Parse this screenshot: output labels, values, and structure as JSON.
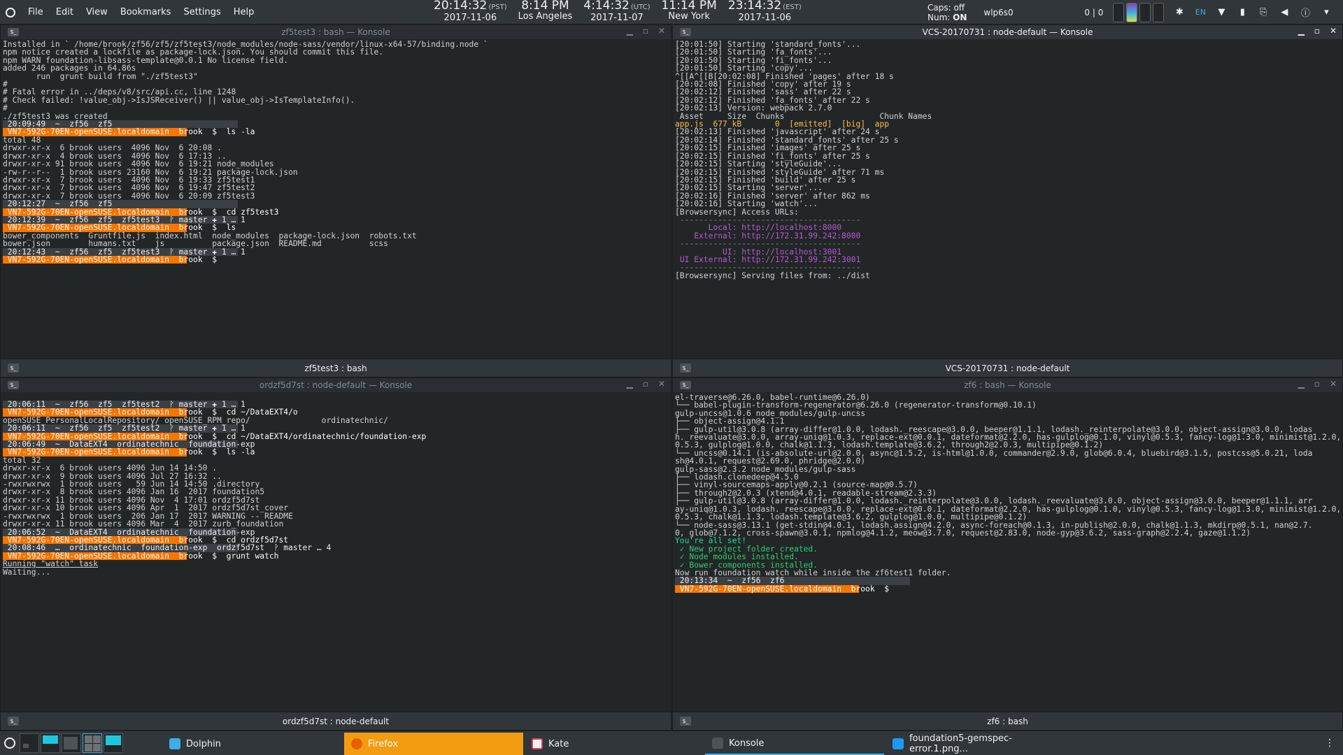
{
  "menubar": {
    "items": [
      "File",
      "Edit",
      "View",
      "Bookmarks",
      "Settings",
      "Help"
    ]
  },
  "clocks": [
    {
      "time": "20:14:32",
      "zone": "(PST)",
      "date": "2017-11-06",
      "city": ""
    },
    {
      "time": "8:14 PM",
      "zone": "",
      "date": "",
      "city": "Los Angeles"
    },
    {
      "time": "4:14:32",
      "zone": "(UTC)",
      "date": "2017-11-07",
      "city": ""
    },
    {
      "time": "11:14 PM",
      "zone": "",
      "date": "",
      "city": "New York"
    },
    {
      "time": "23:14:32",
      "zone": "(EST)",
      "date": "2017-11-06",
      "city": ""
    }
  ],
  "tray": {
    "caps": "Caps: off",
    "num_label": "Num:",
    "num_value": "ON",
    "network": "wlp6s0",
    "pager_text": "0 | 0",
    "lang": "EN"
  },
  "windows": {
    "tl": {
      "title": "zf5test3 : bash — Konsole",
      "tab": "zf5test3 : bash"
    },
    "tr": {
      "title": "VCS-20170731 : node-default — Konsole",
      "tab": "VCS-20170731 : node-default"
    },
    "bl": {
      "title": "ordzf5d7st : node-default — Konsole",
      "tab": "ordzf5d7st : node-default"
    },
    "br": {
      "title": "zf6 : bash — Konsole",
      "tab": "zf6 : bash"
    }
  },
  "term_tl": [
    "Installed in ` /home/brook/zf56/zf5/zf5test3/node_modules/node-sass/vendor/linux-x64-57/binding.node `",
    "npm notice created a lockfile as package-lock.json. You should commit this file.",
    "npm WARN foundation-libsass-template@0.0.1 No license field.",
    "",
    "added 246 packages in 64.86s",
    "       run  grunt build from \"./zf5test3\"",
    "",
    "",
    "#",
    "# Fatal error in ../deps/v8/src/api.cc, line 1248",
    "# Check failed: !value_obj->IsJSReceiver() || value_obj->IsTemplateInfo().",
    "#",
    "./zf5test3 was created",
    " 20:09:49  ~  zf56  zf5",
    " VN7-592G-70EN-openSUSE.localdomain  brook  $  ls -la",
    "total 48",
    "drwxr-xr-x  6 brook users  4096 Nov  6 20:08 .",
    "drwxr-xr-x  4 brook users  4096 Nov  6 17:13 ..",
    "drwxr-xr-x 91 brook users  4096 Nov  6 19:21 node_modules",
    "-rw-r--r--  1 brook users 23160 Nov  6 19:21 package-lock.json",
    "drwxr-xr-x  7 brook users  4096 Nov  6 19:33 zf5test1",
    "drwxr-xr-x  7 brook users  4096 Nov  6 19:47 zf5test2",
    "drwxr-xr-x  7 brook users  4096 Nov  6 20:09 zf5test3",
    " 20:12:27  ~  zf56  zf5",
    " VN7-592G-70EN-openSUSE.localdomain  brook  $  cd zf5test3",
    " 20:12:39  ~  zf56  zf5  zf5test3  ᚹ master ✚ 1 … 1",
    " VN7-592G-70EN-openSUSE.localdomain  brook  $  ls",
    "bower_components  Gruntfile.js  index.html  node_modules  package-lock.json  robots.txt",
    "bower.json        humans.txt    js          package.json  README.md          scss",
    " 20:12:43  ~  zf56  zf5  zf5test3  ᚹ master ✚ 1 … 1",
    " VN7-592G-70EN-openSUSE.localdomain  brook  $  "
  ],
  "term_tr": [
    "[20:01:50] Starting 'standard_fonts'...",
    "[20:01:50] Starting 'fa_fonts'...",
    "[20:01:50] Starting 'fi_fonts'...",
    "[20:01:50] Starting 'copy'...",
    "^[[A^[[B[20:02:08] Finished 'pages' after 18 s",
    "[20:02:08] Finished 'copy' after 19 s",
    "[20:02:12] Finished 'sass' after 22 s",
    "[20:02:12] Finished 'fa_fonts' after 22 s",
    "[20:02:13] Version: webpack 2.7.0",
    " Asset     Size  Chunks                    Chunk Names",
    "app.js  677 kB       0  [emitted]  [big]  app",
    "[20:02:13] Finished 'javascript' after 24 s",
    "[20:02:14] Finished 'standard_fonts' after 25 s",
    "[20:02:15] Finished 'images' after 25 s",
    "[20:02:15] Finished 'fi_fonts' after 25 s",
    "[20:02:15] Starting 'styleGuide'...",
    "[20:02:15] Finished 'styleGuide' after 71 ms",
    "[20:02:15] Finished 'build' after 25 s",
    "[20:02:15] Starting 'server'...",
    "[20:02:16] Finished 'server' after 862 ms",
    "[20:02:16] Starting 'watch'...",
    "[Browsersync] Access URLs:",
    " --------------------------------------",
    "       Local: http://localhost:8000",
    "    External: http://172.31.99.242:8000",
    " --------------------------------------",
    "          UI: http://localhost:3001",
    " UI External: http://172.31.99.242:3001",
    " --------------------------------------",
    "[Browsersync] Serving files from: ../dist",
    ""
  ],
  "term_bl": [
    " 20:06:11  ~  zf56  zf5  zf5test2  ᚹ master ✚ 1 … 1",
    " VN7-592G-70EN-openSUSE.localdomain  brook  $  cd ~/DataEXT4/o",
    "openSUSE_PersonalLocalRepository/ openSUSE_RPM_repo/               ordinatechnic/",
    " 20:06:11  ~  zf56  zf5  zf5test2  ᚹ master ✚ 1 … 1",
    " VN7-592G-70EN-openSUSE.localdomain  brook  $  cd ~/DataEXT4/ordinatechnic/foundation-exp",
    " 20:06:49  ~  DataEXT4  ordinatechnic  foundation-exp",
    " VN7-592G-70EN-openSUSE.localdomain  brook  $  ls -la",
    "total 32",
    "drwxr-xr-x  6 brook users 4096 Jun 14 14:50 .",
    "drwxr-xr-x  9 brook users 4096 Jul 27 16:32 ..",
    "-rwxrwxrwx  1 brook users   59 Jun 14 14:50 .directory",
    "drwxr-xr-x  8 brook users 4096 Jan 16  2017 foundation5",
    "drwxr-xr-x 11 brook users 4096 Nov  4 17:01 ordzf5d7st",
    "drwxr-xr-x 10 brook users 4096 Apr  1  2017 ordzf5d7st_cover",
    "-rwxrwxrwx  1 brook users  206 Jan 17  2017 WARNING -- README",
    "drwxr-xr-x 11 brook users 4096 Mar  4  2017 zurb_foundation",
    " 20:06:52  ~  DataEXT4  ordinatechnic  foundation-exp",
    " VN7-592G-70EN-openSUSE.localdomain  brook  $  cd ordzf5d7st",
    " 20:08:46  …  ordinatechnic  foundation-exp  ordzf5d7st  ᚹ master … 4",
    " VN7-592G-70EN-openSUSE.localdomain  brook  $  grunt watch",
    "Running \"watch\" task",
    "Waiting...",
    ""
  ],
  "term_br": [
    "el-traverse@6.26.0, babel-runtime@6.26.0)",
    "└── babel-plugin-transform-regenerator@6.26.0 (regenerator-transform@0.10.1)",
    "",
    "gulp-uncss@1.0.6 node_modules/gulp-uncss",
    "├── object-assign@4.1.1",
    "├── gulp-util@3.0.8 (array-differ@1.0.0, lodash._reescape@3.0.0, beeper@1.1.1, lodash._reinterpolate@3.0.0, object-assign@3.0.0, lodas",
    "h._reevaluate@3.0.0, array-uniq@1.0.3, replace-ext@0.0.1, dateformat@2.2.0, has-gulplog@0.1.0, vinyl@0.5.3, fancy-log@1.3.0, minimist@1.2.0, vinyl@",
    "0.5.3, gulplog@1.0.0, chalk@1.1.3, lodash.template@3.6.2, through2@2.0.3, multipipe@0.1.2)",
    "└── uncss@0.14.1 (is-absolute-url@2.0.0, async@1.5.2, is-html@1.0.0, commander@2.9.0, glob@6.0.4, bluebird@3.1.5, postcss@5.0.21, loda",
    "sh@4.0.1, request@2.69.0, phridge@2.0.0)",
    "",
    "gulp-sass@2.3.2 node_modules/gulp-sass",
    "├── lodash.clonedeep@4.5.0",
    "├── vinyl-sourcemaps-apply@0.2.1 (source-map@0.5.7)",
    "├── through2@2.0.3 (xtend@4.0.1, readable-stream@2.3.3)",
    "├── gulp-util@3.0.8 (array-differ@1.0.0, lodash._reinterpolate@3.0.0, lodash._reevaluate@3.0.0, object-assign@3.0.0, beeper@1.1.1, arr",
    "ay-uniq@1.0.3, lodash._reescape@3.0.0, replace-ext@0.0.1, dateformat@2.2.0, has-gulplog@0.1.0, vinyl@0.5.3, fancy-log@1.3.0, minimist@1.2.0, vinyl@",
    "0.5.3, chalk@1.1.3, lodash.template@3.6.2, gulplog@1.0.0, multipipe@0.1.2)",
    "└── node-sass@3.13.1 (get-stdin@4.0.1, lodash.assign@4.2.0, async-foreach@0.1.3, in-publish@2.0.0, chalk@1.1.3, mkdirp@0.5.1, nan@2.7.",
    "0, glob@7.1.2, cross-spawn@3.0.1, npmlog@4.1.2, meow@3.7.0, request@2.83.0, node-gyp@3.6.2, sass-graph@2.2.4, gaze@1.1.2)",
    "",
    "You're all set!",
    "",
    " ✓ New project folder created.",
    " ✓ Node modules installed.",
    " ✓ Bower components installed.",
    "",
    "Now run foundation watch while inside the zf6test1 folder.",
    "",
    " 20:13:34  ~  zf56  zf6",
    " VN7-592G-70EN-openSUSE.localdomain  brook  $  "
  ],
  "taskbar": {
    "tasks": [
      {
        "label": "Dolphin",
        "icon": "folder-icon",
        "color": "#3daee9"
      },
      {
        "label": "Firefox",
        "icon": "firefox-icon",
        "color": "#e66000"
      },
      {
        "label": "Kate",
        "icon": "kate-icon",
        "color": "#da4453"
      },
      {
        "label": "Konsole",
        "icon": "konsole-icon",
        "color": "#4d5358"
      },
      {
        "label": "foundation5-gemspec-error.1.png...",
        "icon": "image-icon",
        "color": "#1d99f3"
      }
    ]
  },
  "colors": {
    "accent": "#3daee9",
    "prompt_host": "#f67400",
    "prompt_user": "#1d99f3",
    "firefox_task": "#f39c12"
  }
}
